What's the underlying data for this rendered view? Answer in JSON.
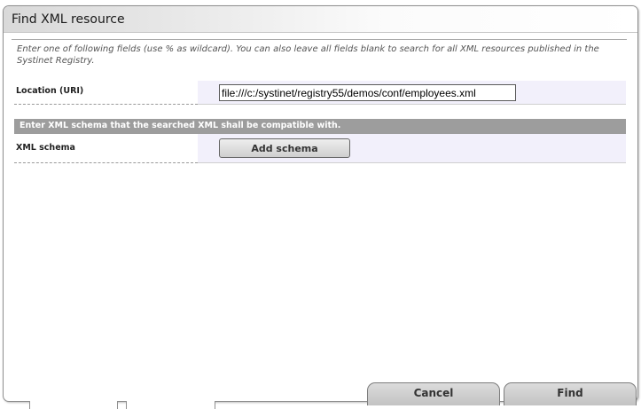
{
  "dialog": {
    "title": "Find XML resource",
    "hint": "Enter one of following fields (use % as wildcard). You can also leave all fields blank to search for all XML resources published in the Systinet Registry."
  },
  "location": {
    "label": "Location (URI)",
    "value": "file:///c:/systinet/registry55/demos/conf/employees.xml"
  },
  "schema_section": {
    "header": "Enter XML schema that the searched XML shall be compatible with.",
    "label": "XML schema",
    "add_button": "Add schema"
  },
  "actions": {
    "cancel": "Cancel",
    "find": "Find"
  },
  "colors": {
    "section_header_bg": "#9d9d9d",
    "value_cell_bg": "#f2f0fb"
  }
}
